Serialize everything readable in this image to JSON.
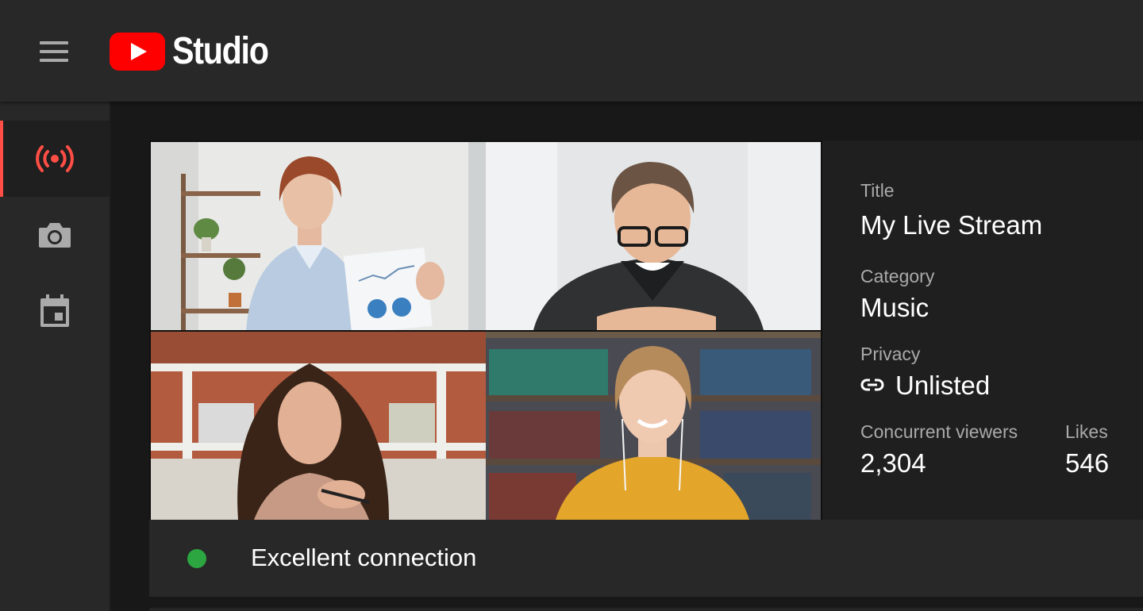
{
  "header": {
    "app_name": "Studio",
    "menu_icon": "hamburger-menu-icon",
    "logo_icon": "youtube-play-logo-icon",
    "brand_red": "#ff0000"
  },
  "sidebar": {
    "items": [
      {
        "icon": "live-broadcast-icon",
        "active": true
      },
      {
        "icon": "camera-icon",
        "active": false
      },
      {
        "icon": "calendar-event-icon",
        "active": false
      }
    ],
    "active_color": "#ff4e45",
    "icon_color": "#aaaaaa"
  },
  "video": {
    "participants": 4
  },
  "stream_info": {
    "title_label": "Title",
    "title_value": "My Live Stream",
    "category_label": "Category",
    "category_value": "Music",
    "privacy_label": "Privacy",
    "privacy_value": "Unlisted",
    "privacy_icon": "link-icon",
    "viewers_label": "Concurrent viewers",
    "viewers_value": "2,304",
    "likes_label": "Likes",
    "likes_value": "546"
  },
  "status": {
    "text": "Excellent connection",
    "color": "#2ba640"
  }
}
